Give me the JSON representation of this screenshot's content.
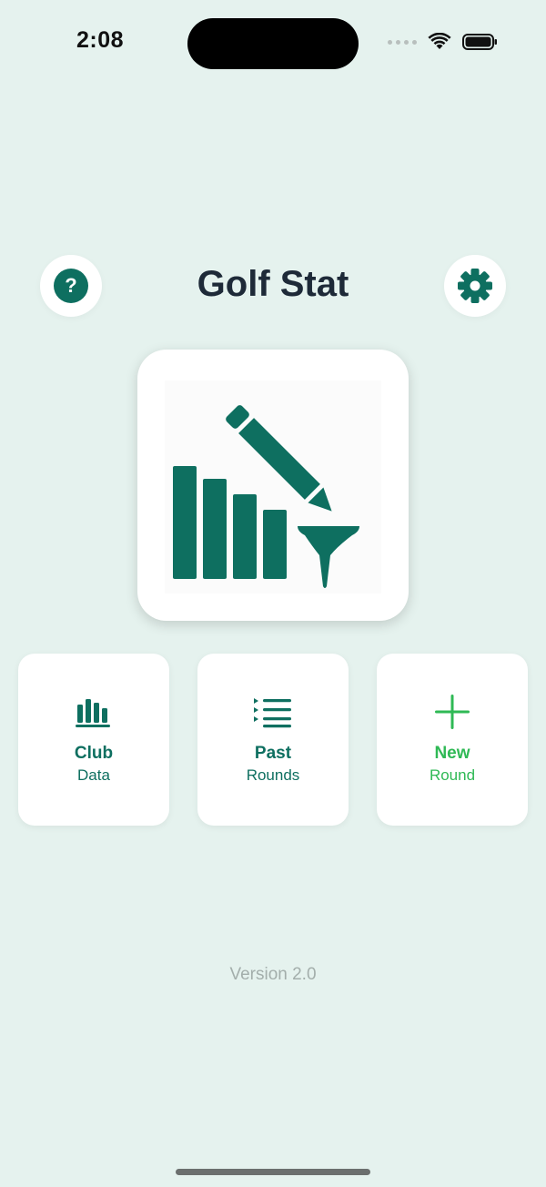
{
  "status_bar": {
    "time": "2:08"
  },
  "header": {
    "title": "Golf Stat",
    "help_symbol": "?",
    "help_icon": "help-question-icon",
    "settings_icon": "gear-icon"
  },
  "logo": {
    "icon": "bar-chart-pencil-golf-tee-logo"
  },
  "actions": [
    {
      "line1": "Club",
      "line2": "Data",
      "icon": "bar-chart-icon"
    },
    {
      "line1": "Past",
      "line2": "Rounds",
      "icon": "list-icon"
    },
    {
      "line1": "New",
      "line2": "Round",
      "icon": "plus-icon"
    }
  ],
  "footer": {
    "version": "Version 2.0"
  },
  "colors": {
    "background": "#e5f2ee",
    "primary": "#0e6f60",
    "accent_green": "#2fb955",
    "title": "#1e2a38",
    "muted": "#a3aeab"
  }
}
